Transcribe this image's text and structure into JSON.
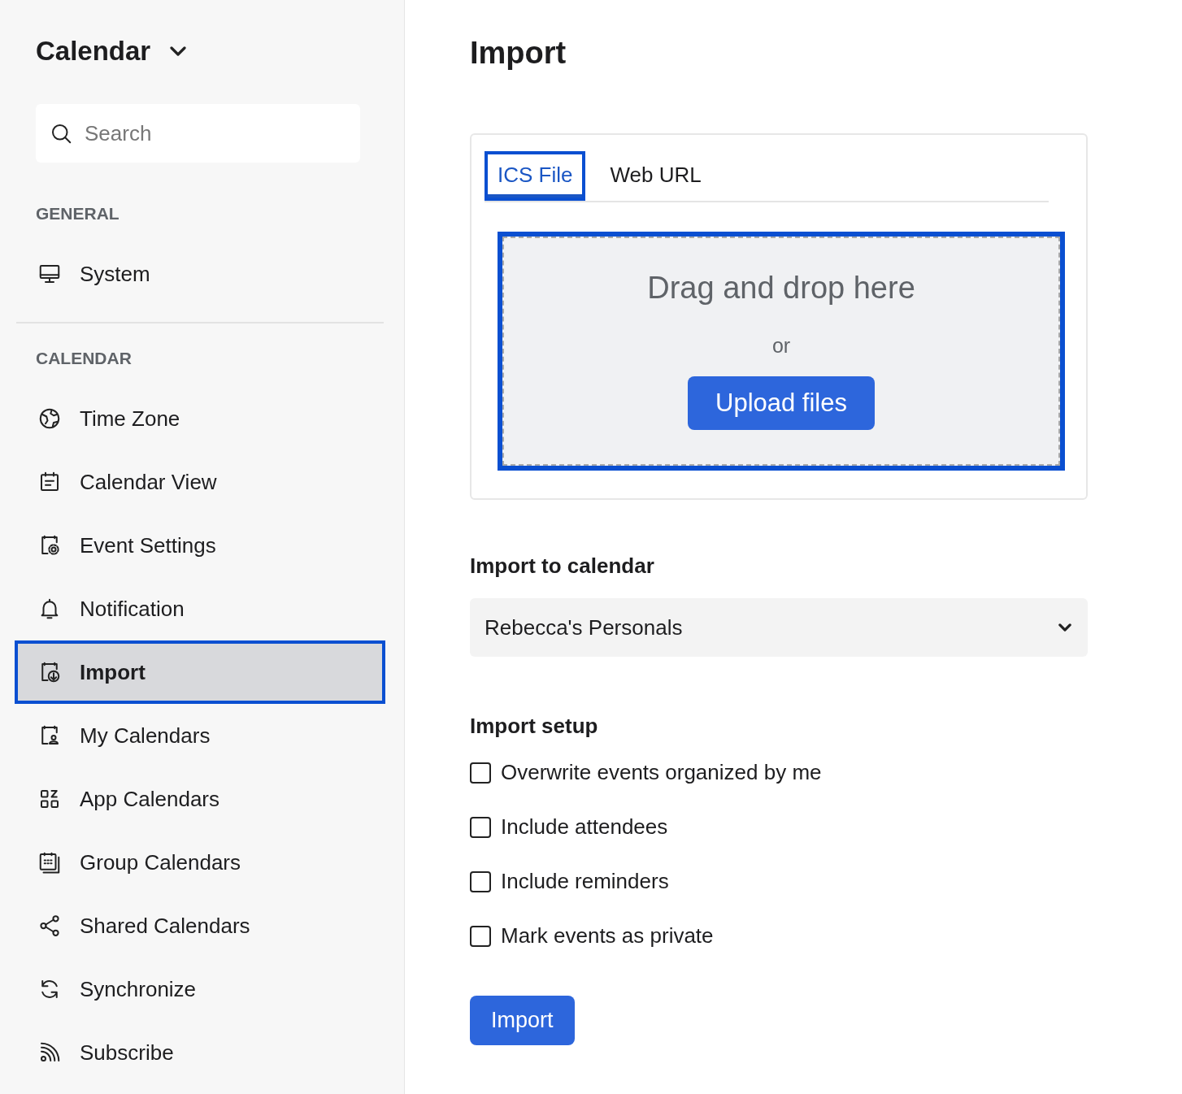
{
  "sidebar": {
    "title": "Calendar",
    "search": {
      "placeholder": "Search"
    },
    "sections": [
      {
        "heading": "GENERAL",
        "items": [
          {
            "label": "System",
            "selected": false,
            "highlighted": false
          }
        ]
      },
      {
        "heading": "CALENDAR",
        "items": [
          {
            "label": "Time Zone",
            "selected": false,
            "highlighted": false
          },
          {
            "label": "Calendar View",
            "selected": false,
            "highlighted": false
          },
          {
            "label": "Event Settings",
            "selected": false,
            "highlighted": false
          },
          {
            "label": "Notification",
            "selected": false,
            "highlighted": false
          },
          {
            "label": "Import",
            "selected": true,
            "highlighted": true
          },
          {
            "label": "My Calendars",
            "selected": false,
            "highlighted": false
          },
          {
            "label": "App Calendars",
            "selected": false,
            "highlighted": false
          },
          {
            "label": "Group Calendars",
            "selected": false,
            "highlighted": false
          },
          {
            "label": "Shared Calendars",
            "selected": false,
            "highlighted": false
          },
          {
            "label": "Synchronize",
            "selected": false,
            "highlighted": false
          },
          {
            "label": "Subscribe",
            "selected": false,
            "highlighted": false
          }
        ]
      }
    ]
  },
  "main": {
    "title": "Import",
    "tabs": [
      {
        "label": "ICS File",
        "selected": true,
        "highlighted": true
      },
      {
        "label": "Web URL",
        "selected": false,
        "highlighted": false
      }
    ],
    "dropzone": {
      "highlighted": true,
      "text": "Drag and drop here",
      "or": "or",
      "button": "Upload files"
    },
    "calendar_label": "Import to calendar",
    "calendar_value": "Rebecca's Personals",
    "setup_label": "Import setup",
    "options": [
      {
        "label": "Overwrite events organized by me",
        "checked": false
      },
      {
        "label": "Include attendees",
        "checked": false
      },
      {
        "label": "Include reminders",
        "checked": false
      },
      {
        "label": "Mark events as private",
        "checked": false
      }
    ],
    "submit": "Import"
  }
}
